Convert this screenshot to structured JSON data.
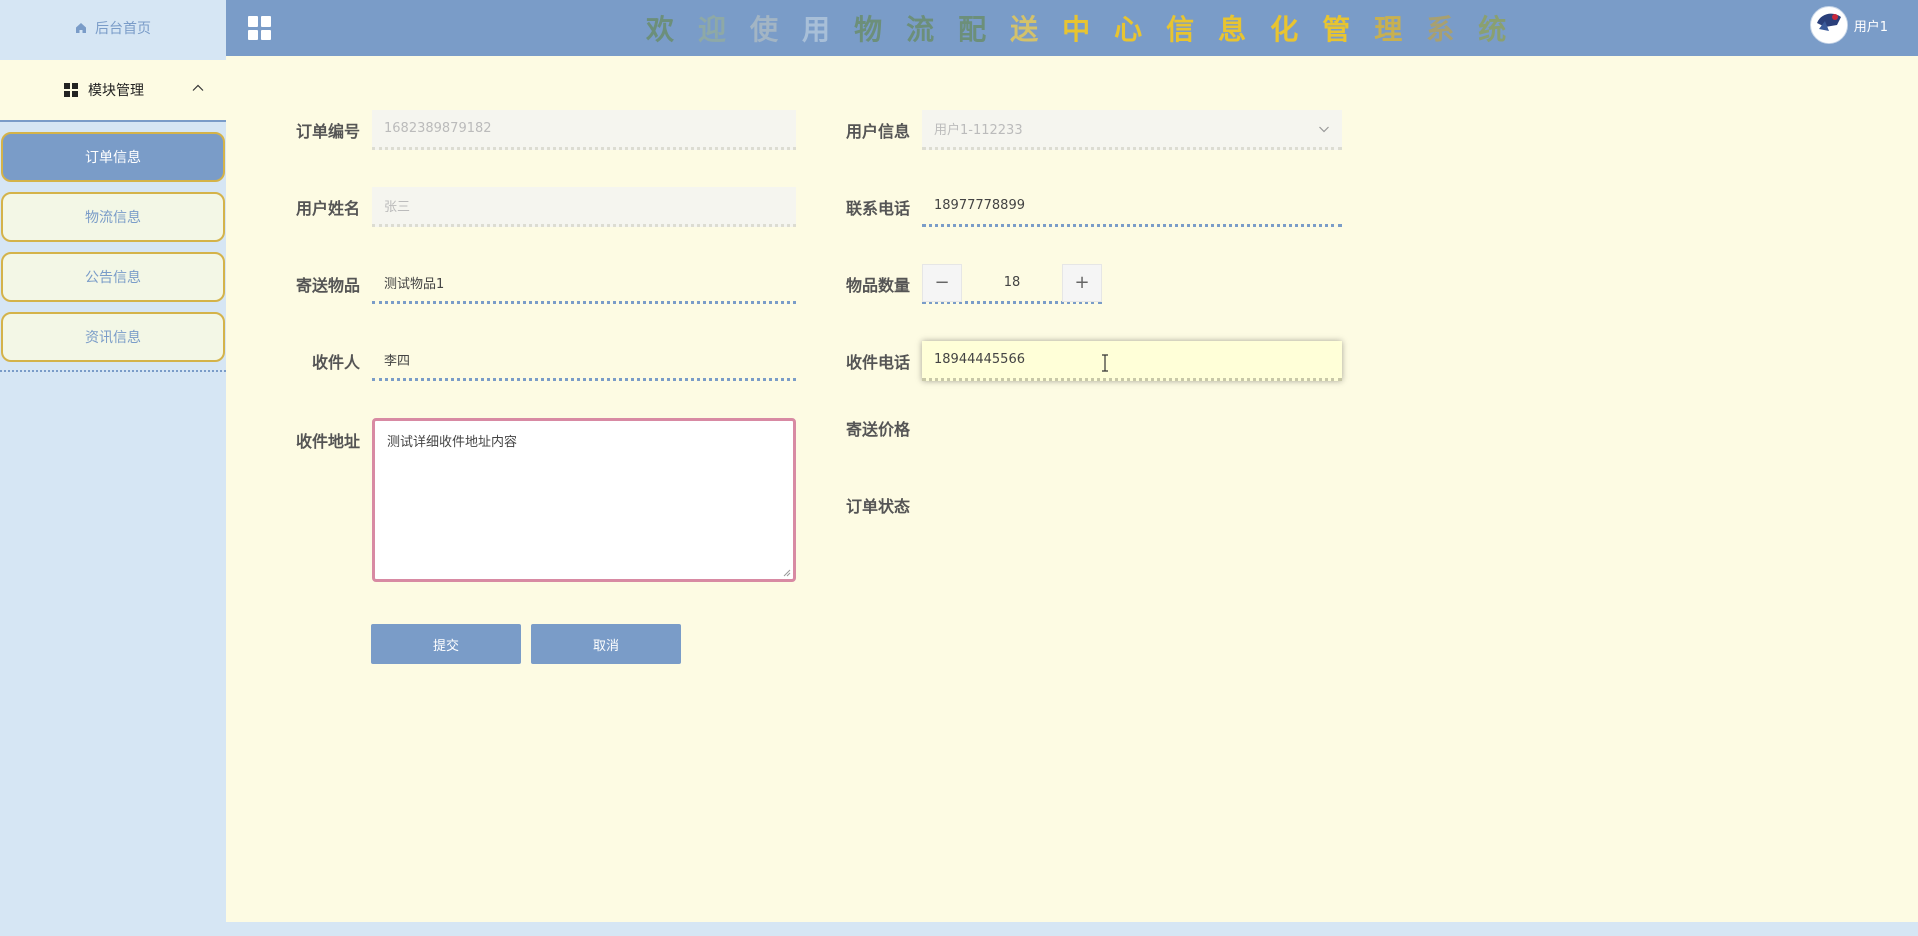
{
  "sidebar": {
    "home_label": "后台首页",
    "module_label": "模块管理",
    "items": [
      {
        "label": "订单信息",
        "active": true
      },
      {
        "label": "物流信息",
        "active": false
      },
      {
        "label": "公告信息",
        "active": false
      },
      {
        "label": "资讯信息",
        "active": false
      }
    ]
  },
  "header": {
    "title_chars": [
      "欢",
      "迎",
      "使",
      "用",
      "物",
      "流",
      "配",
      "送",
      "中",
      "心",
      "信",
      "息",
      "化",
      "管",
      "理",
      "系",
      "统"
    ],
    "title_colors": [
      "#6c8f7a",
      "#8ea9a6",
      "#a3b5c4",
      "#a8bfd8",
      "#6c8f7a",
      "#6c8f7a",
      "#6c8f7a",
      "#d4c26a",
      "#e8c430",
      "#e8c430",
      "#e8c430",
      "#e8c430",
      "#e8c430",
      "#e8c430",
      "#c8b050",
      "#a8a070",
      "#8aa070"
    ],
    "username": "用户1"
  },
  "form": {
    "order_no": {
      "label": "订单编号",
      "value": "1682389879182"
    },
    "user_info": {
      "label": "用户信息",
      "value": "用户1-112233"
    },
    "user_name": {
      "label": "用户姓名",
      "value": "张三"
    },
    "phone": {
      "label": "联系电话",
      "value": "18977778899"
    },
    "item": {
      "label": "寄送物品",
      "value": "测试物品1"
    },
    "quantity": {
      "label": "物品数量",
      "value": "18"
    },
    "receiver": {
      "label": "收件人",
      "value": "李四"
    },
    "receiver_phone": {
      "label": "收件电话",
      "value": "18944445566"
    },
    "address": {
      "label": "收件地址",
      "value": "测试详细收件地址内容"
    },
    "price": {
      "label": "寄送价格"
    },
    "status": {
      "label": "订单状态"
    }
  },
  "buttons": {
    "submit": "提交",
    "cancel": "取消"
  },
  "colors": {
    "accent": "#7a9cc8",
    "main_bg": "#fdfbe3",
    "sidebar_bg": "#d6e6f4",
    "item_border": "#d4b34a",
    "textarea_border": "#d88aa3"
  }
}
